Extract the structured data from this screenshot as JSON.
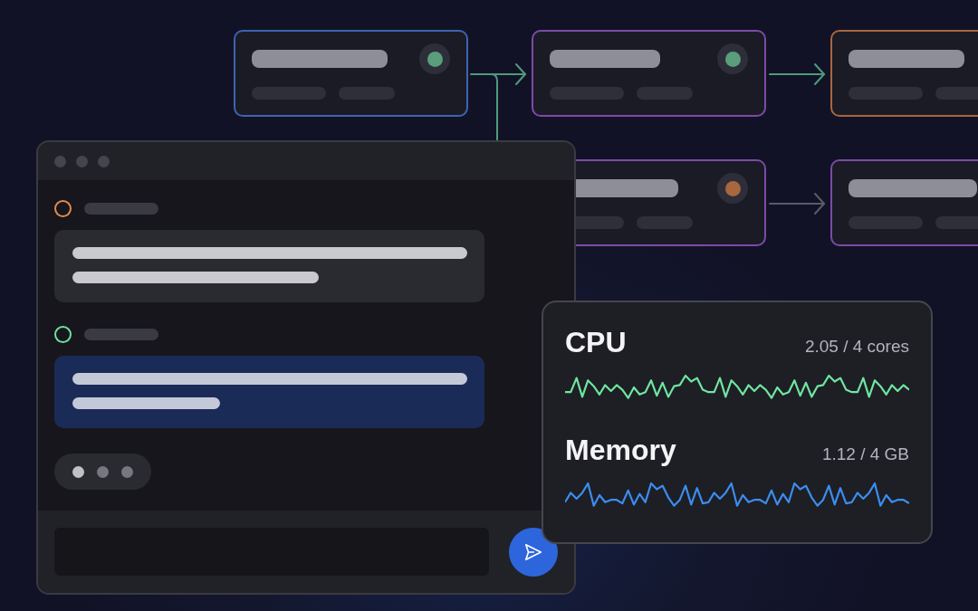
{
  "workflow": {
    "nodes": [
      {
        "color": "#3d64b0",
        "status": {
          "color": "#5a9e7c"
        }
      },
      {
        "color": "#7d4aa8",
        "status": {
          "color": "#5a9e7c"
        }
      },
      {
        "color": "#a8673f"
      },
      {
        "color": "#7d4aa8",
        "status": {
          "color": "#a8673f"
        }
      },
      {
        "color": "#7d4aa8"
      }
    ],
    "edges": [
      {
        "kind": "arrow",
        "active": true
      },
      {
        "kind": "arrow",
        "active": true
      },
      {
        "kind": "arrow",
        "active": false
      },
      {
        "kind": "line",
        "active": true
      }
    ]
  },
  "chat": {
    "messages": [
      {
        "kind": "incoming",
        "color": "#e08a4e"
      },
      {
        "kind": "outgoing",
        "color": "#6fe0a0"
      }
    ],
    "typing": true
  },
  "metrics": [
    {
      "label": "CPU",
      "reading": "2.05 / 4 cores",
      "color": "#6ee6a0"
    },
    {
      "label": "Memory",
      "reading": "1.12 / 4 GB",
      "color": "#3a8ef0"
    }
  ]
}
